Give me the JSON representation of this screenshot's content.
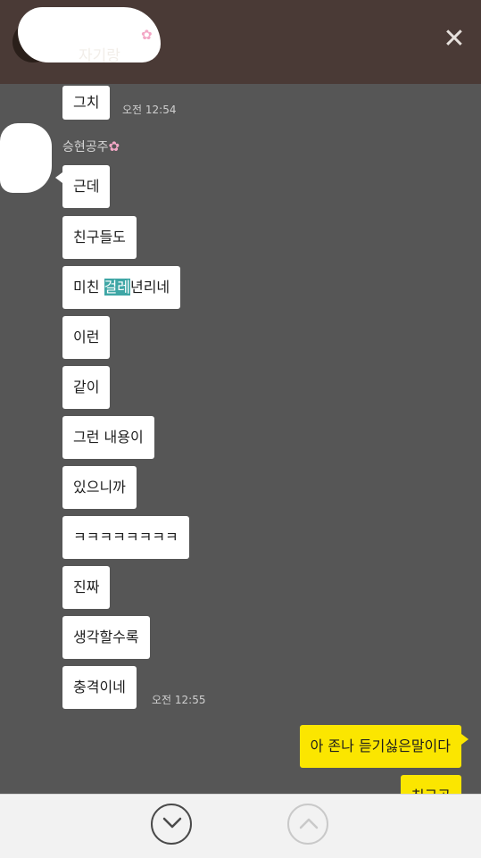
{
  "header": {
    "title": "자기랑",
    "close_icon": "close-icon"
  },
  "left_messages": {
    "top": [
      {
        "text": "그치",
        "time": "오전 12:54"
      }
    ],
    "sender": "승현공주",
    "group": [
      {
        "text": "근데"
      },
      {
        "text": "친구들도"
      },
      {
        "pre": "미친 ",
        "highlight": "걸레",
        "post": "년리네"
      },
      {
        "text": "이런"
      },
      {
        "text": "같이"
      },
      {
        "text": "그런 내용이"
      },
      {
        "text": "있으니까"
      },
      {
        "text": "ㅋㅋㅋㅋㅋㅋㅋㅋ"
      },
      {
        "text": "진짜"
      },
      {
        "text": "생각할수록"
      },
      {
        "text": "충격이네",
        "time": "오전 12:55"
      }
    ]
  },
  "right_messages": [
    {
      "text": "아 존나 듣기싫은말이다"
    },
    {
      "text": "친구공"
    }
  ],
  "footer": {
    "down_icon": "scroll-down-icon",
    "up_icon": "scroll-up-icon"
  },
  "colors": {
    "header": "#4a3a36",
    "background": "#565656",
    "mine": "#fbe600",
    "highlight": "#3ea6a5"
  }
}
